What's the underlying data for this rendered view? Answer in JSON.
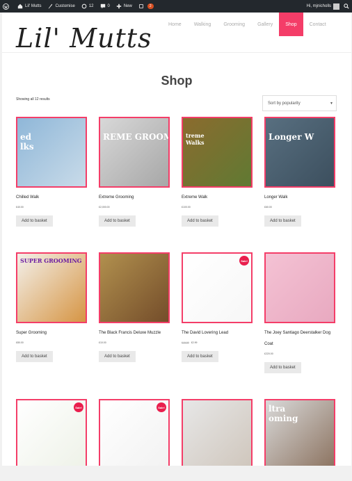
{
  "admin_bar": {
    "site_name": "Lil' Mutts",
    "customise": "Customise",
    "updates_count": "12",
    "comments_count": "0",
    "new_label": "New",
    "notifications_count": "2",
    "greeting": "Hi, mjnicholls"
  },
  "site": {
    "logo_text": "Lil' Mutts",
    "nav": [
      "Home",
      "Walking",
      "Grooming",
      "Gallery",
      "Shop",
      "Contact"
    ],
    "active_nav": "Shop"
  },
  "shop": {
    "title": "Shop",
    "result_count": "Showing all 12 results",
    "sort_selected": "Sort by popularity",
    "add_label": "Add to basket"
  },
  "products": [
    {
      "name": "Chilled Walk",
      "price": "£40.00",
      "sale": false,
      "image_text": "ed\nlks",
      "colors": [
        "#8fb7d8",
        "#c9dbe9"
      ]
    },
    {
      "name": "Extreme Grooming",
      "price": "£2,000.00",
      "sale": false,
      "image_text": "REME GROOM",
      "colors": [
        "#d8d8d8",
        "#a7a7a7"
      ]
    },
    {
      "name": "Extreme Walk",
      "price": "£100.00",
      "sale": false,
      "image_text": "treme\nWalks",
      "colors": [
        "#8b6b2e",
        "#607a33"
      ]
    },
    {
      "name": "Longer Walk",
      "price": "£60.00",
      "sale": false,
      "image_text": "Longer W",
      "colors": [
        "#586f80",
        "#3c4f5e"
      ]
    },
    {
      "name": "Super Grooming",
      "price": "£80.00",
      "sale": false,
      "image_text": "SUPER GROOMING",
      "colors": [
        "#f3f0ea",
        "#d69544"
      ]
    },
    {
      "name": "The Black Francis Deluxe Muzzle",
      "price": "£10.00",
      "sale": false,
      "image_text": "",
      "colors": [
        "#b1904e",
        "#744d2a"
      ]
    },
    {
      "name": "The David Lovering Lead",
      "price": "£2.99",
      "old_price": "£10.00",
      "sale": true,
      "image_text": "",
      "colors": [
        "#ffffff",
        "#f7f7f7"
      ]
    },
    {
      "name": "The Joey Santiago Deerstalker Dog Coat",
      "price": "£220.00",
      "sale": false,
      "image_text": "",
      "colors": [
        "#f4c2d4",
        "#e8a9c0"
      ]
    },
    {
      "name": "",
      "price": "",
      "sale": true,
      "image_text": "",
      "colors": [
        "#ffffff",
        "#eef2e8"
      ]
    },
    {
      "name": "",
      "price": "",
      "sale": true,
      "image_text": "",
      "colors": [
        "#ffffff",
        "#f2f2f2"
      ]
    },
    {
      "name": "",
      "price": "",
      "sale": false,
      "image_text": "",
      "colors": [
        "#e7e7e7",
        "#cfc6bc"
      ]
    },
    {
      "name": "",
      "price": "",
      "sale": false,
      "image_text": "ltra\noming",
      "colors": [
        "#d9d9d9",
        "#8c7360"
      ]
    }
  ],
  "sale_badge": "Sale!"
}
